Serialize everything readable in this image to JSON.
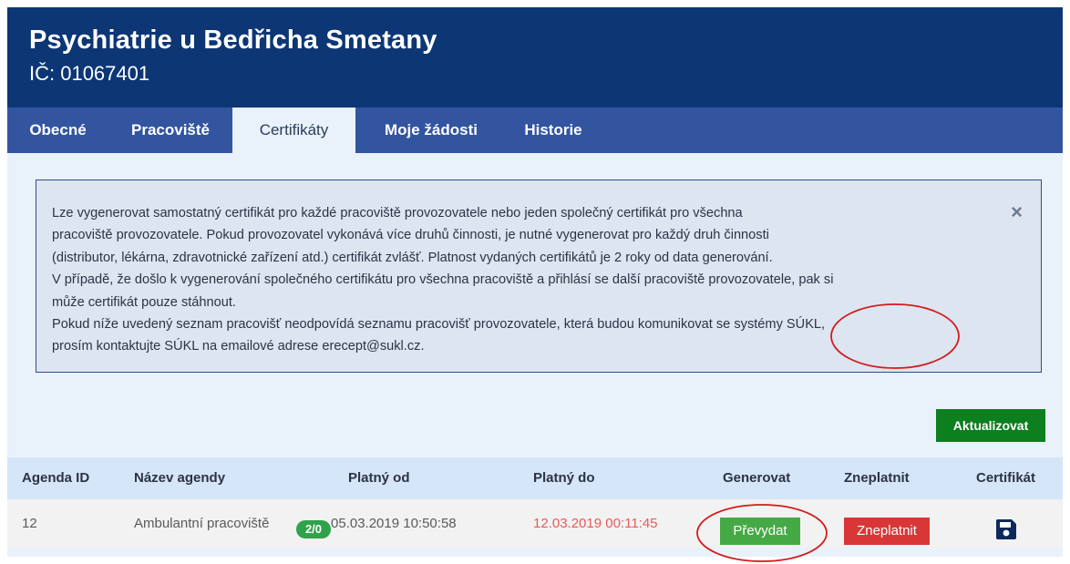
{
  "header": {
    "title": "Psychiatrie u Bedřicha Smetany",
    "ico": "IČ: 01067401"
  },
  "tabs": [
    {
      "label": "Obecné",
      "active": false
    },
    {
      "label": "Pracoviště",
      "active": false
    },
    {
      "label": "Certifikáty",
      "active": true
    },
    {
      "label": "Moje žádosti",
      "active": false
    },
    {
      "label": "Historie",
      "active": false
    }
  ],
  "alert": {
    "lines": [
      "Lze vygenerovat samostatný certifikát pro každé pracoviště provozovatele nebo jeden společný certifikát pro všechna",
      "pracoviště provozovatele. Pokud provozovatel vykonává více druhů činnosti, je nutné vygenerovat pro každý druh činnosti",
      "(distributor, lékárna, zdravotnické zařízení atd.) certifikát zvlášť. Platnost vydaných certifikátů je 2 roky od data generování.",
      "V případě, že došlo k vygenerování společného certifikátu pro všechna pracoviště a přihlásí se další pracoviště provozovatele, pak si",
      "může certifikát pouze stáhnout.",
      "Pokud níže uvedený seznam pracovišť neodpovídá seznamu pracovišť provozovatele, která budou komunikovat se systémy SÚKL,",
      "prosím kontaktujte SÚKL na emailové adrese erecept@sukl.cz."
    ],
    "close_symbol": "×"
  },
  "actions": {
    "refresh_label": "Aktualizovat"
  },
  "table": {
    "headers": {
      "agenda_id": "Agenda ID",
      "name": "Název agendy",
      "valid_from": "Platný od",
      "valid_to": "Platný do",
      "generate": "Generovat",
      "invalidate": "Zneplatnit",
      "certificate": "Certifikát"
    },
    "rows": [
      {
        "agenda_id": "12",
        "name": "Ambulantní pracoviště",
        "badge": "2/0",
        "valid_from": "05.03.2019 10:50:58",
        "valid_to": "12.03.2019 00:11:45",
        "generate_label": "Převydat",
        "invalidate_label": "Zneplatnit",
        "certificate_icon": "save-icon"
      }
    ]
  },
  "colors": {
    "header_bg": "#0d3675",
    "tabbar_bg": "#3355a0",
    "page_bg": "#e9f1fb",
    "refresh_btn": "#0c7f1f",
    "reissue_btn": "#45aa45",
    "invalidate_btn": "#d93737",
    "expired_date": "#e85a5a",
    "annotation": "#d21b1b"
  }
}
